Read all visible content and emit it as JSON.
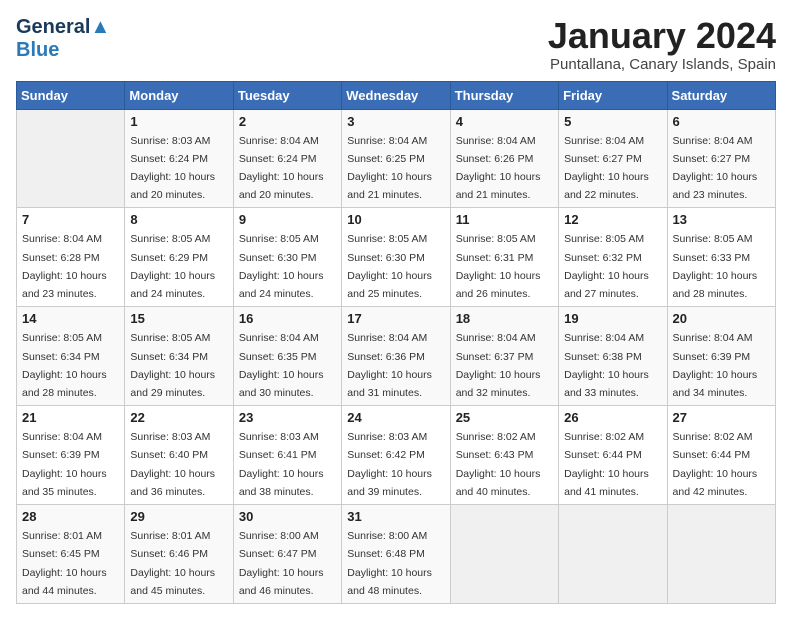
{
  "header": {
    "logo_general": "General",
    "logo_blue": "Blue",
    "month_year": "January 2024",
    "location": "Puntallana, Canary Islands, Spain"
  },
  "days_of_week": [
    "Sunday",
    "Monday",
    "Tuesday",
    "Wednesday",
    "Thursday",
    "Friday",
    "Saturday"
  ],
  "weeks": [
    [
      {
        "day": "",
        "sunrise": "",
        "sunset": "",
        "daylight": ""
      },
      {
        "day": "1",
        "sunrise": "Sunrise: 8:03 AM",
        "sunset": "Sunset: 6:24 PM",
        "daylight": "Daylight: 10 hours and 20 minutes."
      },
      {
        "day": "2",
        "sunrise": "Sunrise: 8:04 AM",
        "sunset": "Sunset: 6:24 PM",
        "daylight": "Daylight: 10 hours and 20 minutes."
      },
      {
        "day": "3",
        "sunrise": "Sunrise: 8:04 AM",
        "sunset": "Sunset: 6:25 PM",
        "daylight": "Daylight: 10 hours and 21 minutes."
      },
      {
        "day": "4",
        "sunrise": "Sunrise: 8:04 AM",
        "sunset": "Sunset: 6:26 PM",
        "daylight": "Daylight: 10 hours and 21 minutes."
      },
      {
        "day": "5",
        "sunrise": "Sunrise: 8:04 AM",
        "sunset": "Sunset: 6:27 PM",
        "daylight": "Daylight: 10 hours and 22 minutes."
      },
      {
        "day": "6",
        "sunrise": "Sunrise: 8:04 AM",
        "sunset": "Sunset: 6:27 PM",
        "daylight": "Daylight: 10 hours and 23 minutes."
      }
    ],
    [
      {
        "day": "7",
        "sunrise": "Sunrise: 8:04 AM",
        "sunset": "Sunset: 6:28 PM",
        "daylight": "Daylight: 10 hours and 23 minutes."
      },
      {
        "day": "8",
        "sunrise": "Sunrise: 8:05 AM",
        "sunset": "Sunset: 6:29 PM",
        "daylight": "Daylight: 10 hours and 24 minutes."
      },
      {
        "day": "9",
        "sunrise": "Sunrise: 8:05 AM",
        "sunset": "Sunset: 6:30 PM",
        "daylight": "Daylight: 10 hours and 24 minutes."
      },
      {
        "day": "10",
        "sunrise": "Sunrise: 8:05 AM",
        "sunset": "Sunset: 6:30 PM",
        "daylight": "Daylight: 10 hours and 25 minutes."
      },
      {
        "day": "11",
        "sunrise": "Sunrise: 8:05 AM",
        "sunset": "Sunset: 6:31 PM",
        "daylight": "Daylight: 10 hours and 26 minutes."
      },
      {
        "day": "12",
        "sunrise": "Sunrise: 8:05 AM",
        "sunset": "Sunset: 6:32 PM",
        "daylight": "Daylight: 10 hours and 27 minutes."
      },
      {
        "day": "13",
        "sunrise": "Sunrise: 8:05 AM",
        "sunset": "Sunset: 6:33 PM",
        "daylight": "Daylight: 10 hours and 28 minutes."
      }
    ],
    [
      {
        "day": "14",
        "sunrise": "Sunrise: 8:05 AM",
        "sunset": "Sunset: 6:34 PM",
        "daylight": "Daylight: 10 hours and 28 minutes."
      },
      {
        "day": "15",
        "sunrise": "Sunrise: 8:05 AM",
        "sunset": "Sunset: 6:34 PM",
        "daylight": "Daylight: 10 hours and 29 minutes."
      },
      {
        "day": "16",
        "sunrise": "Sunrise: 8:04 AM",
        "sunset": "Sunset: 6:35 PM",
        "daylight": "Daylight: 10 hours and 30 minutes."
      },
      {
        "day": "17",
        "sunrise": "Sunrise: 8:04 AM",
        "sunset": "Sunset: 6:36 PM",
        "daylight": "Daylight: 10 hours and 31 minutes."
      },
      {
        "day": "18",
        "sunrise": "Sunrise: 8:04 AM",
        "sunset": "Sunset: 6:37 PM",
        "daylight": "Daylight: 10 hours and 32 minutes."
      },
      {
        "day": "19",
        "sunrise": "Sunrise: 8:04 AM",
        "sunset": "Sunset: 6:38 PM",
        "daylight": "Daylight: 10 hours and 33 minutes."
      },
      {
        "day": "20",
        "sunrise": "Sunrise: 8:04 AM",
        "sunset": "Sunset: 6:39 PM",
        "daylight": "Daylight: 10 hours and 34 minutes."
      }
    ],
    [
      {
        "day": "21",
        "sunrise": "Sunrise: 8:04 AM",
        "sunset": "Sunset: 6:39 PM",
        "daylight": "Daylight: 10 hours and 35 minutes."
      },
      {
        "day": "22",
        "sunrise": "Sunrise: 8:03 AM",
        "sunset": "Sunset: 6:40 PM",
        "daylight": "Daylight: 10 hours and 36 minutes."
      },
      {
        "day": "23",
        "sunrise": "Sunrise: 8:03 AM",
        "sunset": "Sunset: 6:41 PM",
        "daylight": "Daylight: 10 hours and 38 minutes."
      },
      {
        "day": "24",
        "sunrise": "Sunrise: 8:03 AM",
        "sunset": "Sunset: 6:42 PM",
        "daylight": "Daylight: 10 hours and 39 minutes."
      },
      {
        "day": "25",
        "sunrise": "Sunrise: 8:02 AM",
        "sunset": "Sunset: 6:43 PM",
        "daylight": "Daylight: 10 hours and 40 minutes."
      },
      {
        "day": "26",
        "sunrise": "Sunrise: 8:02 AM",
        "sunset": "Sunset: 6:44 PM",
        "daylight": "Daylight: 10 hours and 41 minutes."
      },
      {
        "day": "27",
        "sunrise": "Sunrise: 8:02 AM",
        "sunset": "Sunset: 6:44 PM",
        "daylight": "Daylight: 10 hours and 42 minutes."
      }
    ],
    [
      {
        "day": "28",
        "sunrise": "Sunrise: 8:01 AM",
        "sunset": "Sunset: 6:45 PM",
        "daylight": "Daylight: 10 hours and 44 minutes."
      },
      {
        "day": "29",
        "sunrise": "Sunrise: 8:01 AM",
        "sunset": "Sunset: 6:46 PM",
        "daylight": "Daylight: 10 hours and 45 minutes."
      },
      {
        "day": "30",
        "sunrise": "Sunrise: 8:00 AM",
        "sunset": "Sunset: 6:47 PM",
        "daylight": "Daylight: 10 hours and 46 minutes."
      },
      {
        "day": "31",
        "sunrise": "Sunrise: 8:00 AM",
        "sunset": "Sunset: 6:48 PM",
        "daylight": "Daylight: 10 hours and 48 minutes."
      },
      {
        "day": "",
        "sunrise": "",
        "sunset": "",
        "daylight": ""
      },
      {
        "day": "",
        "sunrise": "",
        "sunset": "",
        "daylight": ""
      },
      {
        "day": "",
        "sunrise": "",
        "sunset": "",
        "daylight": ""
      }
    ]
  ]
}
